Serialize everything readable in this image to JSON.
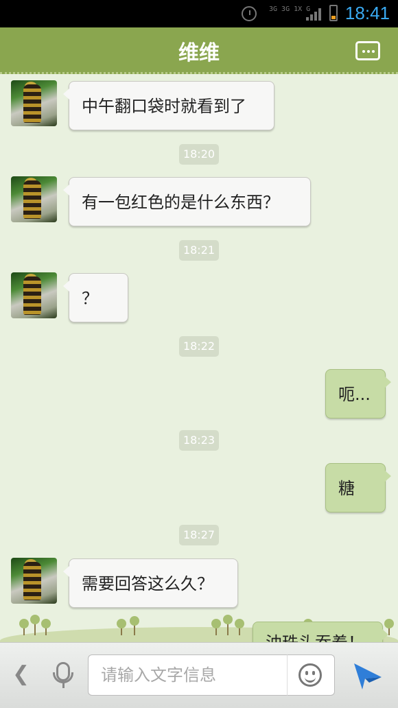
{
  "status_bar": {
    "time": "18:41",
    "network": "3G 3G 1X G",
    "icons": [
      "alarm-icon",
      "network-type-icon",
      "signal-icon",
      "battery-icon"
    ]
  },
  "header": {
    "title": "维维",
    "menu_icon": "more-dots-icon"
  },
  "messages": [
    {
      "side": "in",
      "text": "中午翻口袋时就看到了"
    },
    {
      "time": "18:20"
    },
    {
      "side": "in",
      "text": "有一包红色的是什么东西？"
    },
    {
      "time": "18:21"
    },
    {
      "side": "in",
      "text": "？"
    },
    {
      "time": "18:22"
    },
    {
      "side": "out",
      "text": "呃..."
    },
    {
      "time": "18:23"
    },
    {
      "side": "out",
      "text": "糖"
    },
    {
      "time": "18:27"
    },
    {
      "side": "in",
      "text": "需要回答这么久？"
    },
    {
      "side": "out",
      "text": "油珠头吞着！"
    }
  ],
  "input_bar": {
    "placeholder": "请输入文字信息",
    "value": "",
    "icons": [
      "back-arrow-icon",
      "microphone-icon",
      "emoji-icon",
      "send-icon"
    ]
  },
  "colors": {
    "title_bar": "#8aa64f",
    "chat_background": "#e9f1df",
    "outgoing_bubble": "#c7dca6",
    "incoming_bubble": "#f7f7f6",
    "status_time": "#3aaaf2"
  }
}
